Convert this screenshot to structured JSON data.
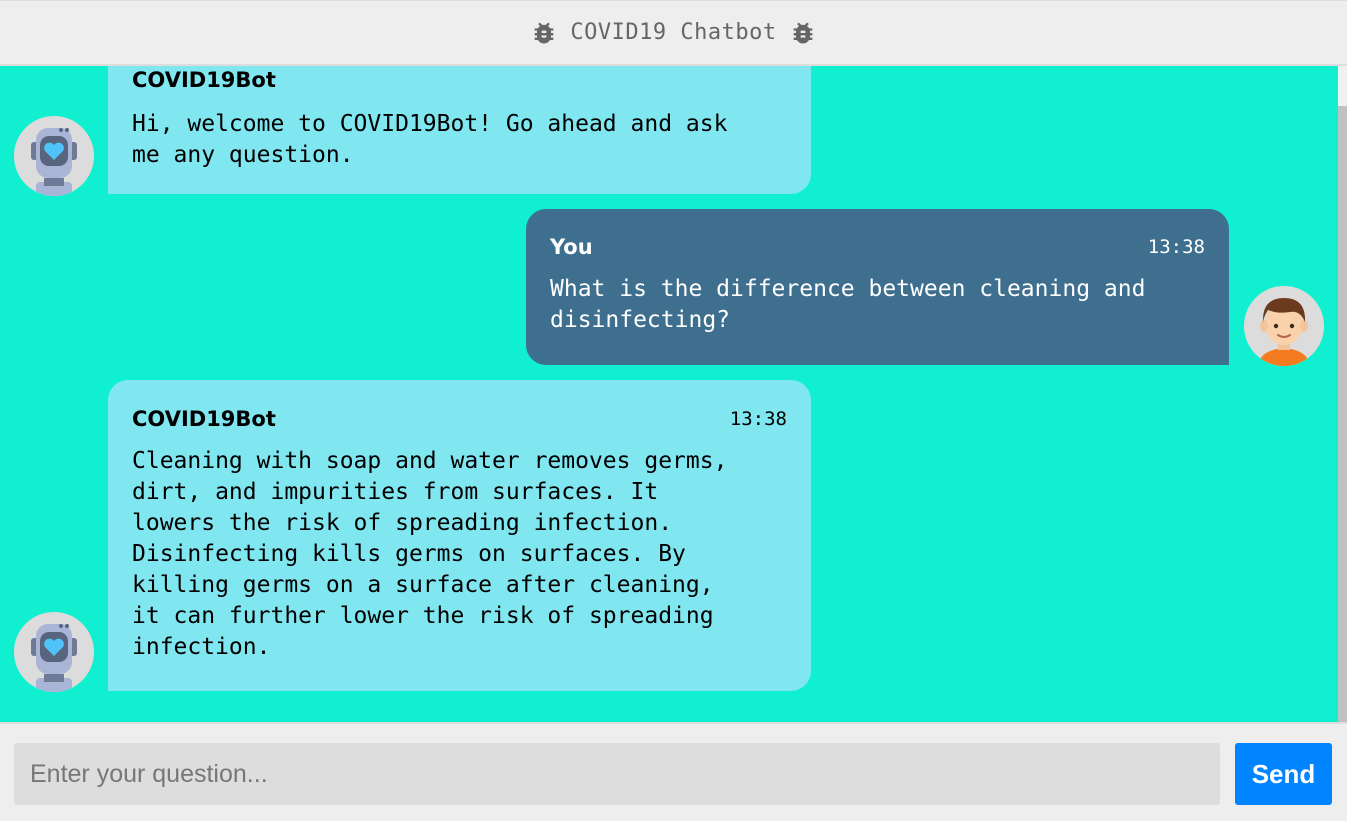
{
  "header": {
    "title": "COVID19 Chatbot",
    "icon_left": "bug-icon",
    "icon_right": "bug-icon",
    "text_color": "#666666"
  },
  "chat": {
    "background": "#10f0d0",
    "messages": [
      {
        "sender": "bot",
        "name": "COVID19Bot",
        "time": "",
        "text": "Hi, welcome to COVID19Bot! Go ahead and ask\nme any question.",
        "avatar_icon": "robot-avatar-icon"
      },
      {
        "sender": "user",
        "name": "You",
        "time": "13:38",
        "text": "What is the difference between cleaning and\ndisinfecting?",
        "avatar_icon": "user-avatar-icon"
      },
      {
        "sender": "bot",
        "name": "COVID19Bot",
        "time": "13:38",
        "text": "Cleaning with soap and water removes germs,\ndirt, and impurities from surfaces. It\nlowers the risk of spreading infection.\nDisinfecting kills germs on surfaces. By\nkilling germs on a surface after cleaning,\nit can further lower the risk of spreading\ninfection.",
        "avatar_icon": "robot-avatar-icon"
      }
    ],
    "bot_bubble_color": "#80e6f0",
    "user_bubble_color": "#3f6f8f"
  },
  "footer": {
    "input_placeholder": "Enter your question...",
    "input_value": "",
    "send_label": "Send",
    "send_color": "#0084ff"
  }
}
